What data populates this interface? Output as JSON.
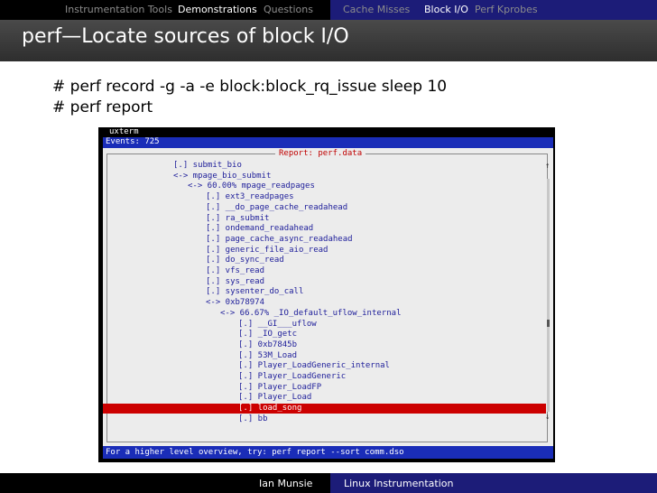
{
  "nav": {
    "sections": [
      "Instrumentation Tools",
      "Demonstrations",
      "Questions"
    ],
    "subsections": [
      "Cache Misses",
      "Block I/O",
      "Perf Kprobes"
    ]
  },
  "title": "perf—Locate sources of block I/O",
  "commands": [
    "# perf record -g -a -e block:block_rq_issue sleep 10",
    "# perf report"
  ],
  "terminal": {
    "window_title": "uxterm",
    "events": "Events: 725",
    "report_title": "Report: perf.data",
    "lines": [
      "[.] submit_bio",
      "<-> mpage_bio_submit",
      "<-> 60.00% mpage_readpages",
      "[.] ext3_readpages",
      "[.] __do_page_cache_readahead",
      "[.] ra_submit",
      "[.] ondemand_readahead",
      "[.] page_cache_async_readahead",
      "[.] generic_file_aio_read",
      "[.] do_sync_read",
      "[.] vfs_read",
      "[.] sys_read",
      "[.] sysenter_do_call",
      "<-> 0xb78974",
      "<-> 66.67% _IO_default_uflow_internal",
      "[.] __GI___uflow",
      "[.] _IO_getc",
      "[.] 0xb7845b",
      "[.] 53M_Load",
      "[.] Player_LoadGeneric_internal",
      "[.] Player_LoadGeneric",
      "[.] Player_LoadFP",
      "[.] Player_Load",
      "[.] load_song",
      "[.] bb"
    ],
    "arrow_up": "↑",
    "arrow_down": "↓",
    "hint": "For a higher level overview, try: perf report --sort comm.dso"
  },
  "footer": {
    "author": "Ian Munsie",
    "talk": "Linux Instrumentation"
  }
}
